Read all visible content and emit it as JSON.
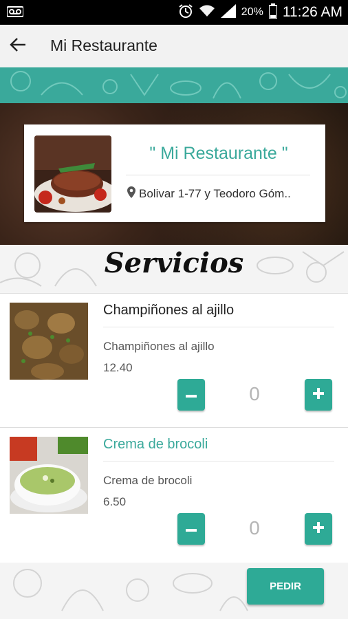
{
  "status_bar": {
    "battery_percent": "20%",
    "time": "11:26 AM",
    "icons": [
      "voicemail-icon",
      "alarm-icon",
      "wifi-icon",
      "signal-icon",
      "battery-icon"
    ]
  },
  "app_bar": {
    "title": "Mi Restaurante",
    "back_icon": "arrow-left-icon"
  },
  "restaurant": {
    "name": "\" Mi Restaurante \"",
    "address": "Bolivar 1-77 y Teodoro Góm..",
    "address_icon": "map-pin-icon"
  },
  "section": {
    "title": "Servicios"
  },
  "items": [
    {
      "name": "Champiñones al ajillo",
      "description": "Champiñones al ajillo",
      "price": "12.40",
      "quantity": "0",
      "minus_label": "−",
      "plus_label": "+"
    },
    {
      "name": "Crema de brocoli",
      "description": "Crema de brocoli",
      "price": "6.50",
      "quantity": "0",
      "minus_label": "−",
      "plus_label": "+"
    }
  ],
  "footer": {
    "order_label": "PEDIR"
  },
  "colors": {
    "accent": "#2eaa96",
    "title_teal": "#3aa99b"
  }
}
